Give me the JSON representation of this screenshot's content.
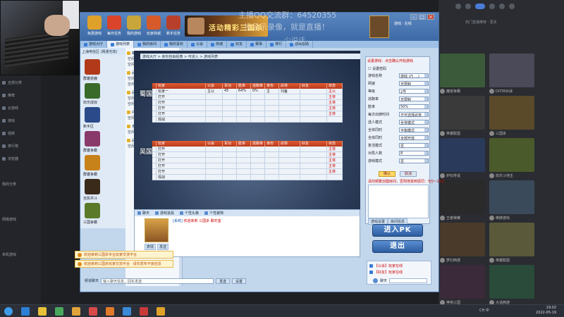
{
  "sidebar": {
    "items": [
      {
        "label": "全部分类"
      },
      {
        "label": "推荐"
      },
      {
        "label": "云游戏"
      },
      {
        "label": "游戏"
      },
      {
        "label": "视频"
      },
      {
        "label": "排行榜"
      },
      {
        "label": "浏览器"
      }
    ],
    "sections": [
      {
        "label": "我的分类"
      },
      {
        "label": "网络游戏"
      },
      {
        "label": "单机游戏"
      }
    ]
  },
  "overlay": {
    "line1": "主播QQ交流群：64520355",
    "line2": "投显示录像，就是直播！",
    "line3": "少说话..."
  },
  "window": {
    "toolbar": [
      {
        "label": "免费游戏",
        "color": "#e0a12a"
      },
      {
        "label": "每日任务",
        "color": "#d9442b"
      },
      {
        "label": "我的游戏",
        "color": "#c8a63a"
      },
      {
        "label": "玩家商城",
        "color": "#d65a2a"
      },
      {
        "label": "新手任务",
        "color": "#b8402a"
      }
    ],
    "banner_text": "活动精彩三国杀",
    "user_line": "游戏 · 在线"
  },
  "tabs": [
    {
      "label": "游戏大厅"
    },
    {
      "label": "游戏列表"
    },
    {
      "label": "我的房间"
    },
    {
      "label": "我的喜欢"
    },
    {
      "label": "公会"
    },
    {
      "label": "商城"
    },
    {
      "label": "好友"
    },
    {
      "label": "赛事"
    },
    {
      "label": "排行"
    },
    {
      "label": "游戏帮助"
    }
  ],
  "tree": {
    "header": "上海电信区 (网通无效)",
    "modules": [
      {
        "label": "群雄逐鹿",
        "color": "#b23a1a"
      },
      {
        "label": "欢乐成双",
        "color": "#3a6a2a"
      },
      {
        "label": "新手区",
        "color": "#2a4a8a"
      },
      {
        "label": "群雄争霸",
        "color": "#8a3a6a"
      },
      {
        "label": "群雄争霸",
        "color": "#c8821a"
      },
      {
        "label": "全民共斗",
        "color": "#3a2a1a"
      },
      {
        "label": "三国争霸",
        "color": "#5a7a2a"
      }
    ]
  },
  "rooms": {
    "groups": [
      {
        "title": "新手专区",
        "rows": [
          {
            "name": "空闲",
            "count": "0",
            "state": "可进入"
          },
          {
            "name": "空闲",
            "count": "0",
            "state": "可进入"
          }
        ]
      },
      {
        "title": "武勋争霸场",
        "rows": [
          {
            "name": "空闲",
            "count": "0",
            "state": "可进入"
          },
          {
            "name": "空闲",
            "count": "0",
            "state": "可进入"
          }
        ]
      },
      {
        "title": "武勋争霸场",
        "rows": [
          {
            "name": "空闲",
            "count": "0",
            "state": "可进入"
          },
          {
            "name": "空闲",
            "count": "0",
            "state": "可进入"
          }
        ]
      },
      {
        "title": "问鼎自由自在场",
        "rows": [
          {
            "name": "空闲",
            "count": "0",
            "state": "可进入"
          }
        ]
      },
      {
        "title": "身份自由经典",
        "rows": [
          {
            "name": "空闲",
            "count": "0",
            "state": "可进入"
          }
        ]
      },
      {
        "title": "武勋自由场",
        "rows": [
          {
            "name": "空闲",
            "count": "0",
            "state": "可进入"
          }
        ]
      }
    ]
  },
  "board": {
    "breadcrumb": "游戏大厅 > 身份自由经典 > 可进入 > 游戏列表",
    "headers": [
      "",
      "玩家",
      "公会",
      "军功",
      "胜率",
      "逃跑率",
      "身份",
      "武将",
      "好友",
      "状态"
    ],
    "factions": [
      {
        "label": "蜀国"
      },
      {
        "label": "吴国"
      }
    ],
    "team_a": [
      {
        "c0": "",
        "c1": "玩家一",
        "c2": "主公",
        "c3": "45",
        "c4": "64%",
        "c5": "0%",
        "c6": "主",
        "c7": "刘备",
        "c8": "",
        "c9": "主公"
      },
      {
        "c0": "",
        "c1": "打开",
        "c2": "",
        "c3": "",
        "c4": "",
        "c5": "",
        "c6": "",
        "c7": "",
        "c8": "",
        "c9": "主将"
      },
      {
        "c0": "",
        "c1": "打开",
        "c2": "",
        "c3": "",
        "c4": "",
        "c5": "",
        "c6": "",
        "c7": "",
        "c8": "",
        "c9": "主将"
      },
      {
        "c0": "",
        "c1": "打开",
        "c2": "",
        "c3": "",
        "c4": "",
        "c5": "",
        "c6": "",
        "c7": "",
        "c8": "",
        "c9": "主将"
      },
      {
        "c0": "",
        "c1": "打开",
        "c2": "",
        "c3": "",
        "c4": "",
        "c5": "",
        "c6": "",
        "c7": "",
        "c8": "",
        "c9": "主将"
      },
      {
        "c0": "",
        "c1": "观战",
        "c2": "",
        "c3": "",
        "c4": "",
        "c5": "",
        "c6": "",
        "c7": "",
        "c8": "",
        "c9": ""
      }
    ],
    "team_b": [
      {
        "c0": "",
        "c1": "打开",
        "c2": "",
        "c3": "",
        "c4": "",
        "c5": "",
        "c6": "",
        "c7": "",
        "c8": "",
        "c9": "主将"
      },
      {
        "c0": "",
        "c1": "打开",
        "c2": "",
        "c3": "",
        "c4": "",
        "c5": "",
        "c6": "",
        "c7": "",
        "c8": "",
        "c9": "主将"
      },
      {
        "c0": "",
        "c1": "打开",
        "c2": "",
        "c3": "",
        "c4": "",
        "c5": "",
        "c6": "",
        "c7": "",
        "c8": "",
        "c9": "主将"
      },
      {
        "c0": "",
        "c1": "打开",
        "c2": "",
        "c3": "",
        "c4": "",
        "c5": "",
        "c6": "",
        "c7": "",
        "c8": "",
        "c9": "主将"
      },
      {
        "c0": "",
        "c1": "打开",
        "c2": "",
        "c3": "",
        "c4": "",
        "c5": "",
        "c6": "",
        "c7": "",
        "c8": "",
        "c9": "主将"
      },
      {
        "c0": "",
        "c1": "观战",
        "c2": "",
        "c3": "",
        "c4": "",
        "c5": "",
        "c6": "",
        "c7": "",
        "c8": "",
        "c9": ""
      }
    ]
  },
  "settings": {
    "title": "设置游戏：点击确认开始游戏",
    "checkbox_label": "设置密码",
    "rows": [
      {
        "label": "游戏名称",
        "value": "游戏 (乃 ...)"
      },
      {
        "label": "网速",
        "value": "无限制"
      },
      {
        "label": "等级",
        "value": "2号"
      },
      {
        "label": "逃跑率",
        "value": "无限制"
      },
      {
        "label": "胜率",
        "value": "50%"
      },
      {
        "label": "每次出牌时间",
        "value": "不可选择武将"
      },
      {
        "label": "选人模式",
        "value": "全将模式"
      },
      {
        "label": "全体同时",
        "value": "平衡模式"
      },
      {
        "label": "全体同时",
        "value": "全部开放"
      },
      {
        "label": "复活模式",
        "value": "否"
      },
      {
        "label": "对局人数",
        "value": "8"
      },
      {
        "label": "游戏模式",
        "value": "否"
      }
    ],
    "confirm": "确认",
    "cancel": "取消",
    "note": "请勿频繁创建房间，否则将受到惩罚：5分~15分",
    "tabs": [
      "游戏设置",
      "房间信息"
    ]
  },
  "buttons": {
    "enter_pk": "进入PK",
    "exit": "退出"
  },
  "chat": {
    "tabs": [
      {
        "label": "聊天"
      },
      {
        "label": "游戏道具"
      },
      {
        "label": "个性头像"
      },
      {
        "label": "个性装饰"
      }
    ],
    "line_who": "[系统]",
    "line_text": "欢迎来到 三国杀 聊天室",
    "side_buttons": [
      "表情",
      "发送"
    ]
  },
  "notices": [
    "欢迎来到三国杀专业玩家交流平台",
    "欢迎来到三国杀玩家交流平台 · 请勿发布不良信息"
  ],
  "input": {
    "label": "频道聊天",
    "placeholder": "输入聊天信息，回车发送",
    "send": "发送",
    "settings": "设置"
  },
  "friends": {
    "rows": [
      "【公会】玩家在线",
      "【好友】玩家在线"
    ],
    "ctl_label": "聊天"
  },
  "right_panel": {
    "header": "热门直播推荐 · 更多",
    "tiles": [
      {
        "caption": "魔兽争霸",
        "color": "#3b5a3a"
      },
      {
        "caption": "DOTA对战",
        "color": "#4a4a58"
      },
      {
        "caption": "英雄联盟",
        "color": "#3a3a3a"
      },
      {
        "caption": "三国杀",
        "color": "#5a4a2a"
      },
      {
        "caption": "炉石传说",
        "color": "#2a3a5a"
      },
      {
        "caption": "欢乐斗地主",
        "color": "#4a5a2a"
      },
      {
        "caption": "王者荣耀",
        "color": "#2a2a2a"
      },
      {
        "caption": "棋牌游戏",
        "color": "#3a4a5a"
      },
      {
        "caption": "梦幻西游",
        "color": "#4a3a2a"
      },
      {
        "caption": "英雄联盟",
        "color": "#5a5a3a"
      },
      {
        "caption": "神将三国",
        "color": "#3a2a3a"
      },
      {
        "caption": "大话西游",
        "color": "#2a4a3a"
      }
    ]
  },
  "taskbar": {
    "apps": [
      {
        "name": "start",
        "color": "#3f9be8"
      },
      {
        "name": "qq",
        "color": "#2d7fd6"
      },
      {
        "name": "penguin",
        "color": "#e8c13a"
      },
      {
        "name": "browser",
        "color": "#4aa85c"
      },
      {
        "name": "folder",
        "color": "#e0a43a"
      },
      {
        "name": "media",
        "color": "#d64a4a"
      },
      {
        "name": "game",
        "color": "#e07a2a"
      },
      {
        "name": "app",
        "color": "#3a8ad6"
      },
      {
        "name": "app2",
        "color": "#c83a3a"
      },
      {
        "name": "app3",
        "color": "#e0a12a"
      }
    ],
    "tray": "CH 中",
    "time": "19:02",
    "date": "2022-05-19"
  }
}
